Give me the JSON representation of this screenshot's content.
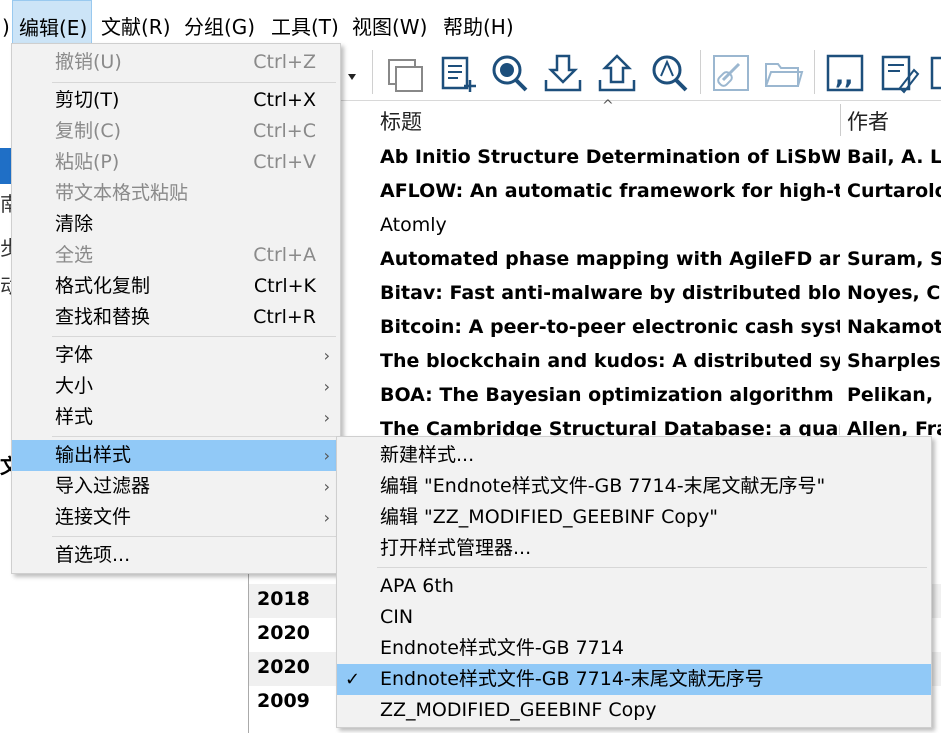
{
  "menubar": {
    "items": [
      {
        "label": ")"
      },
      {
        "label": "编辑(E)"
      },
      {
        "label": "文献(R)"
      },
      {
        "label": "分组(G)"
      },
      {
        "label": "工具(T)"
      },
      {
        "label": "视图(W)"
      },
      {
        "label": "帮助(H)"
      }
    ]
  },
  "toolbar": {
    "icons": [
      "dropdown-arrow-icon",
      "copy-to-library-icon",
      "new-reference-icon",
      "online-search-icon",
      "import-icon",
      "export-icon",
      "find-fulltext-icon",
      "open-link-icon",
      "open-file-icon",
      "insert-citation-icon",
      "edit-reference-icon"
    ]
  },
  "left_pane": {
    "chars": [
      "南",
      "步",
      "动"
    ],
    "bold_char": "文"
  },
  "references": {
    "columns": {
      "title": "标题",
      "author": "作者"
    },
    "rows": [
      {
        "year": "",
        "title": "Ab Initio Structure Determination of LiSbW...",
        "author": "Bail, A. L.",
        "bold": true
      },
      {
        "year": "",
        "title": "AFLOW: An automatic framework for high-t...",
        "author": "Curtarolo",
        "bold": true
      },
      {
        "year": "",
        "title": "Atomly",
        "author": "",
        "bold": false
      },
      {
        "year": "",
        "title": "Automated phase mapping with AgileFD an...",
        "author": "Suram, Sa",
        "bold": true
      },
      {
        "year": "",
        "title": "Bitav: Fast anti-malware by distributed bloc...",
        "author": "Noyes, Ch",
        "bold": true
      },
      {
        "year": "",
        "title": "Bitcoin: A peer-to-peer electronic cash system",
        "author": "Nakamoto",
        "bold": true
      },
      {
        "year": "",
        "title": "The blockchain and kudos: A distributed sys...",
        "author": "Sharples,",
        "bold": true
      },
      {
        "year": "",
        "title": "BOA: The Bayesian optimization algorithm",
        "author": "Pelikan, M",
        "bold": true
      },
      {
        "year": "",
        "title": "The Cambridge Structural Database: a quart...",
        "author": "Allen, Fra",
        "bold": true
      }
    ],
    "year_rows": [
      "2018",
      "2020",
      "2020",
      "2009"
    ]
  },
  "edit_menu": {
    "items": [
      {
        "label": "撤销(U)",
        "shortcut": "Ctrl+Z",
        "disabled": true
      },
      {
        "label": "剪切(T)",
        "shortcut": "Ctrl+X",
        "disabled": false
      },
      {
        "label": "复制(C)",
        "shortcut": "Ctrl+C",
        "disabled": true
      },
      {
        "label": "粘贴(P)",
        "shortcut": "Ctrl+V",
        "disabled": true
      },
      {
        "label": "带文本格式粘贴",
        "shortcut": "",
        "disabled": true
      },
      {
        "label": "清除",
        "shortcut": "",
        "disabled": false
      },
      {
        "label": "全选",
        "shortcut": "Ctrl+A",
        "disabled": true
      },
      {
        "label": "格式化复制",
        "shortcut": "Ctrl+K",
        "disabled": false
      },
      {
        "label": "查找和替换",
        "shortcut": "Ctrl+R",
        "disabled": false
      },
      {
        "label": "字体",
        "submenu": true
      },
      {
        "label": "大小",
        "submenu": true
      },
      {
        "label": "样式",
        "submenu": true
      },
      {
        "label": "输出样式",
        "submenu": true,
        "highlighted": true
      },
      {
        "label": "导入过滤器",
        "submenu": true
      },
      {
        "label": "连接文件",
        "submenu": true
      },
      {
        "label": "首选项..."
      }
    ]
  },
  "style_submenu": {
    "items": [
      {
        "label": "新建样式..."
      },
      {
        "label": "编辑 \"Endnote样式文件-GB 7714-末尾文献无序号\""
      },
      {
        "label": "编辑 \"ZZ_MODIFIED_GEEBINF Copy\""
      },
      {
        "label": "打开样式管理器..."
      },
      {
        "label": "APA 6th"
      },
      {
        "label": "CIN"
      },
      {
        "label": "Endnote样式文件-GB 7714"
      },
      {
        "label": "Endnote样式文件-GB 7714-末尾文献无序号",
        "checked": true
      },
      {
        "label": "ZZ_MODIFIED_GEEBINF Copy"
      }
    ],
    "check_glyph": "✓"
  },
  "colors": {
    "highlight": "#91c9f7",
    "menu_bg": "#f2f2f2",
    "toolbar_icon": "#1d4f7c"
  }
}
